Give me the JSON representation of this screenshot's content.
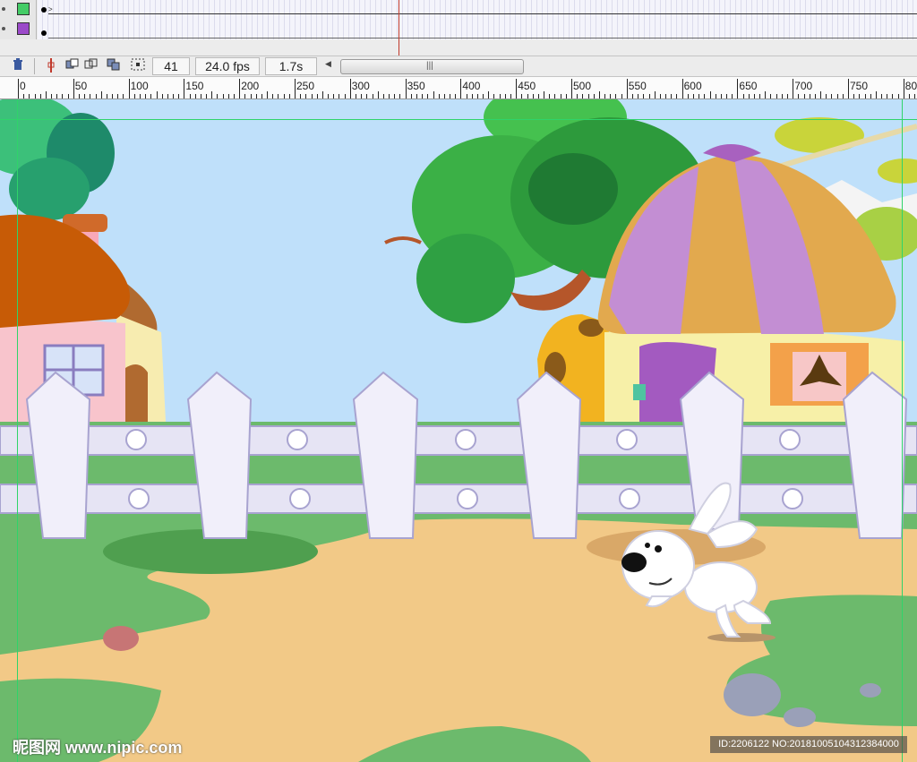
{
  "timeline": {
    "layers": [
      {
        "color": "#44cc66"
      },
      {
        "color": "#9b49c9"
      }
    ]
  },
  "toolbar": {
    "frame": "41",
    "fps": "24.0 fps",
    "time": "1.7s"
  },
  "ruler": {
    "labels": [
      "0",
      "50",
      "100",
      "150",
      "200",
      "250",
      "300",
      "350",
      "400",
      "450",
      "500",
      "550",
      "600",
      "650",
      "700",
      "750",
      "80"
    ]
  },
  "watermark": {
    "site": "昵图网 www.nipic.com",
    "id": "ID:2206122 NO:20181005104312384000"
  },
  "colors": {
    "sky": "#bfe0fa",
    "grass": "#6cba6c",
    "path": "#f2c987",
    "fence": "#e6e4f4",
    "playhead": "#c0392b",
    "guide": "#2fd46a"
  }
}
